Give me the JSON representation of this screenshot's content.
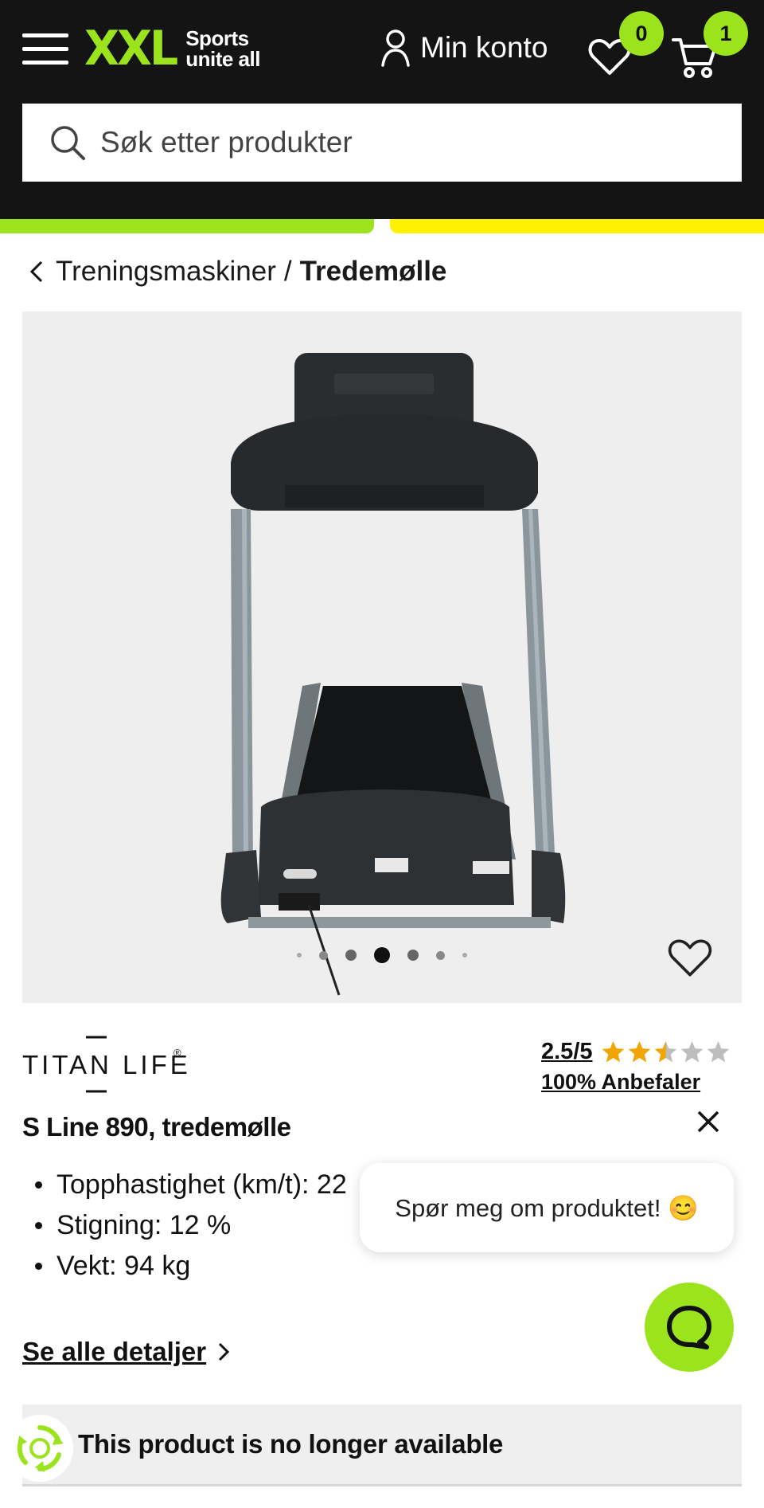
{
  "header": {
    "logo": {
      "mark": "XXL",
      "slogan_line1": "Sports",
      "slogan_line2": "unite all"
    },
    "account_label": "Min konto",
    "wishlist_count": "0",
    "cart_count": "1",
    "icons": [
      "menu-icon",
      "user-icon",
      "heart-icon",
      "cart-icon",
      "search-icon"
    ]
  },
  "search": {
    "placeholder": "Søk etter produkter"
  },
  "breadcrumb": {
    "parent": "Treningsmaskiner",
    "separator": "/",
    "current": "Tredemølle"
  },
  "gallery": {
    "image_count": 7,
    "active_index": 3
  },
  "product": {
    "brand": "TITAN LIFE",
    "brand_mark": "®",
    "title": "S Line 890, tredemølle",
    "rating": {
      "score_text": "2.5/5",
      "value": 2.5,
      "max": 5,
      "recommend": "100% Anbefaler"
    },
    "specs": [
      "Topphastighet (km/t): 22",
      "Stigning: 12 %",
      "Vekt: 94 kg"
    ],
    "details_link": "Se alle detaljer",
    "availability": "This product is no longer available"
  },
  "chat": {
    "prompt": "Spør meg om produktet! 😊"
  },
  "colors": {
    "brand_green": "#9be31c",
    "brand_yellow": "#fff200",
    "header_bg": "#141414",
    "star": "#f0a500"
  }
}
